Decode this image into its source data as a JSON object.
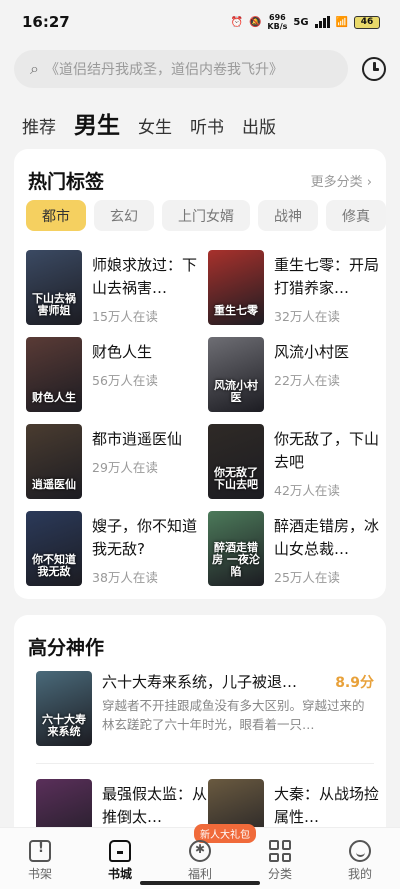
{
  "status": {
    "time": "16:27",
    "net_speed": "696",
    "net_unit": "KB/s",
    "network": "5G",
    "battery": "46"
  },
  "search": {
    "placeholder": "《道侣结丹我成圣，道侣内卷我飞升》"
  },
  "tabs": [
    {
      "label": "推荐",
      "active": false
    },
    {
      "label": "男生",
      "active": true
    },
    {
      "label": "女生",
      "active": false
    },
    {
      "label": "听书",
      "active": false
    },
    {
      "label": "出版",
      "active": false
    }
  ],
  "hot_tags": {
    "title": "热门标签",
    "more": "更多分类 ›",
    "chips": [
      "都市",
      "玄幻",
      "上门女婿",
      "战神",
      "修真"
    ],
    "books": [
      {
        "title": "师娘求放过：下山去祸害…",
        "readers": "15万人在读",
        "cover_text": "下山去祸害师姐",
        "cover_color": "#3b4a63"
      },
      {
        "title": "重生七零：开局打猎养家…",
        "readers": "32万人在读",
        "cover_text": "重生七零",
        "cover_color": "#a8312c"
      },
      {
        "title": "财色人生",
        "readers": "56万人在读",
        "cover_text": "财色人生",
        "cover_color": "#5a3b36"
      },
      {
        "title": "风流小村医",
        "readers": "22万人在读",
        "cover_text": "风流小村医",
        "cover_color": "#6e6e74"
      },
      {
        "title": "都市逍遥医仙",
        "readers": "29万人在读",
        "cover_text": "逍遥医仙",
        "cover_color": "#4a3c30"
      },
      {
        "title": "你无敌了，下山去吧",
        "readers": "42万人在读",
        "cover_text": "你无敌了下山去吧",
        "cover_color": "#2f2a26"
      },
      {
        "title": "嫂子，你不知道我无敌?",
        "readers": "38万人在读",
        "cover_text": "你不知道我无敌",
        "cover_color": "#2b3a5a"
      },
      {
        "title": "醉酒走错房，冰山女总裁…",
        "readers": "25万人在读",
        "cover_text": "醉酒走错房 一夜沦陷",
        "cover_color": "#4c7a5a"
      }
    ]
  },
  "high_rated": {
    "title": "高分神作",
    "top": {
      "title": "六十大寿来系统，儿子被退…",
      "score": "8.9分",
      "desc": "穿越者不开挂跟咸鱼没有多大区别。穿越过来的林玄蹉跎了六十年时光，眼看着一只…",
      "cover_text": "六十大寿来系统",
      "cover_color": "#4a6a7a"
    },
    "books": [
      {
        "title": "最强假太监：从推倒太…",
        "cover_color": "#5a2f5a"
      },
      {
        "title": "大秦：从战场捡属性…",
        "cover_color": "#6a5a40"
      }
    ]
  },
  "nav": {
    "badge": "新人大礼包",
    "items": [
      {
        "label": "书架",
        "icon": "bookshelf-icon",
        "active": false
      },
      {
        "label": "书城",
        "icon": "home-icon",
        "active": true
      },
      {
        "label": "福利",
        "icon": "gift-icon",
        "active": false
      },
      {
        "label": "分类",
        "icon": "grid-icon",
        "active": false
      },
      {
        "label": "我的",
        "icon": "profile-icon",
        "active": false
      }
    ]
  }
}
